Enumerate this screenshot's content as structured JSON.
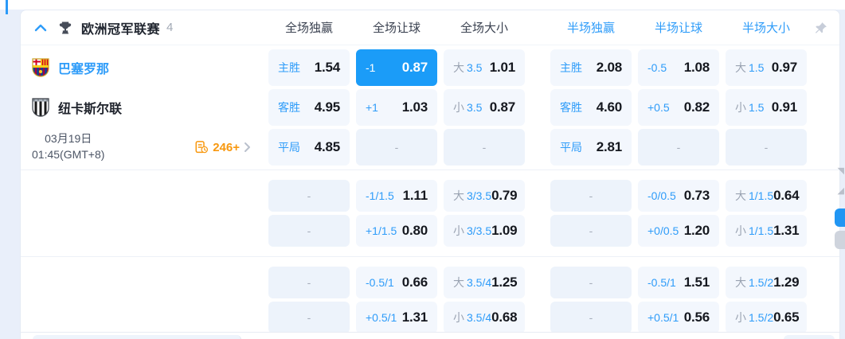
{
  "header": {
    "league_name": "欧洲冠军联赛",
    "match_count": "4",
    "columns": [
      {
        "label": "全场独赢",
        "half": false
      },
      {
        "label": "全场让球",
        "half": false
      },
      {
        "label": "全场大小",
        "half": false
      },
      {
        "label": "半场独赢",
        "half": true
      },
      {
        "label": "半场让球",
        "half": true
      },
      {
        "label": "半场大小",
        "half": true
      }
    ],
    "icons": {
      "collapse": "chevron-up",
      "league": "trophy",
      "pin": "pushpin"
    }
  },
  "match": {
    "home_name": "巴塞罗那",
    "away_name": "纽卡斯尔联",
    "date_line1": "03月19日",
    "date_line2": "01:45(GMT+8)",
    "more_markets_count": "246+"
  },
  "misc": {
    "dash": "-"
  },
  "colors": {
    "accent_blue": "#2e9cf9",
    "selected_cell_bg": "#1b9cf8",
    "orange": "#f8980f",
    "odds_text": "#15181f",
    "cell_bg": "#f3f7fd",
    "empty_cell_bg": "#edf3fb"
  },
  "sections": [
    {
      "rows": [
        {
          "left": "home",
          "cells": [
            {
              "label": "主胜",
              "odds": "1.54"
            },
            {
              "line": "-1",
              "odds": "0.87",
              "selected": true
            },
            {
              "prefix": "大",
              "line": "3.5",
              "odds": "1.01"
            },
            {
              "label": "主胜",
              "odds": "2.08"
            },
            {
              "line": "-0.5",
              "odds": "1.08"
            },
            {
              "prefix": "大",
              "line": "1.5",
              "odds": "0.97"
            }
          ]
        },
        {
          "left": "away",
          "cells": [
            {
              "label": "客胜",
              "odds": "4.95"
            },
            {
              "line": "+1",
              "odds": "1.03"
            },
            {
              "prefix": "小",
              "line": "3.5",
              "odds": "0.87"
            },
            {
              "label": "客胜",
              "odds": "4.60"
            },
            {
              "line": "+0.5",
              "odds": "0.82"
            },
            {
              "prefix": "小",
              "line": "1.5",
              "odds": "0.91"
            }
          ]
        },
        {
          "left": "meta",
          "cells": [
            {
              "label": "平局",
              "odds": "4.85"
            },
            {
              "empty": true
            },
            {
              "empty": true
            },
            {
              "label": "平局",
              "odds": "2.81"
            },
            {
              "empty": true
            },
            {
              "empty": true
            }
          ]
        }
      ]
    },
    {
      "rows": [
        {
          "left": "none",
          "cells": [
            {
              "empty": true
            },
            {
              "line": "-1/1.5",
              "odds": "1.11"
            },
            {
              "prefix": "大",
              "line": "3/3.5",
              "odds": "0.79"
            },
            {
              "empty": true
            },
            {
              "line": "-0/0.5",
              "odds": "0.73"
            },
            {
              "prefix": "大",
              "line": "1/1.5",
              "odds": "0.64"
            }
          ]
        },
        {
          "left": "none",
          "cells": [
            {
              "empty": true
            },
            {
              "line": "+1/1.5",
              "odds": "0.80"
            },
            {
              "prefix": "小",
              "line": "3/3.5",
              "odds": "1.09"
            },
            {
              "empty": true
            },
            {
              "line": "+0/0.5",
              "odds": "1.20"
            },
            {
              "prefix": "小",
              "line": "1/1.5",
              "odds": "1.31"
            }
          ]
        }
      ]
    },
    {
      "rows": [
        {
          "left": "none",
          "cells": [
            {
              "empty": true
            },
            {
              "line": "-0.5/1",
              "odds": "0.66"
            },
            {
              "prefix": "大",
              "line": "3.5/4",
              "odds": "1.25"
            },
            {
              "empty": true
            },
            {
              "line": "-0.5/1",
              "odds": "1.51"
            },
            {
              "prefix": "大",
              "line": "1.5/2",
              "odds": "1.29"
            }
          ]
        },
        {
          "left": "none",
          "cells": [
            {
              "empty": true
            },
            {
              "line": "+0.5/1",
              "odds": "1.31"
            },
            {
              "prefix": "小",
              "line": "3.5/4",
              "odds": "0.68"
            },
            {
              "empty": true
            },
            {
              "line": "+0.5/1",
              "odds": "0.56"
            },
            {
              "prefix": "小",
              "line": "1.5/2",
              "odds": "0.65"
            }
          ]
        }
      ]
    }
  ]
}
